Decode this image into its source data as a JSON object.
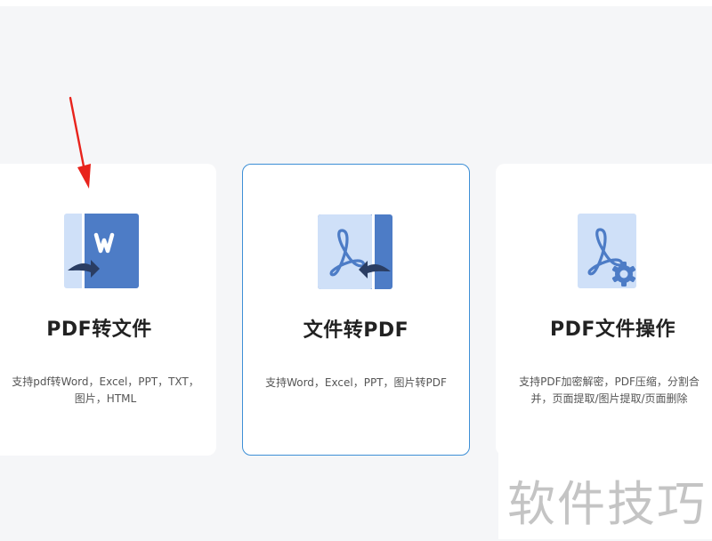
{
  "page": {
    "top_strip": true
  },
  "cards": [
    {
      "title": "PDF转文件",
      "description_lines": [
        "支持pdf转Word，Excel，PPT，TXT，",
        "图片，HTML"
      ],
      "icon": "pdf-to-word-icon",
      "active": false
    },
    {
      "title": "文件转PDF",
      "description_lines": [
        "支持Word，Excel，PPT，图片转PDF"
      ],
      "icon": "file-to-pdf-icon",
      "active": true
    },
    {
      "title": "PDF文件操作",
      "description_lines": [
        "支持PDF加密解密，PDF压缩，分割合",
        "并，页面提取/图片提取/页面删除"
      ],
      "icon": "pdf-settings-icon",
      "active": false
    }
  ],
  "annotation": {
    "icon": "red-arrow-icon",
    "color": "#e8231c"
  },
  "watermark": {
    "text": "软件技巧"
  },
  "colors": {
    "accent": "#3d8fd6",
    "icon_dark": "#4d7cc6",
    "icon_light": "#cfe0f8",
    "icon_arrow": "#2a3d63"
  }
}
